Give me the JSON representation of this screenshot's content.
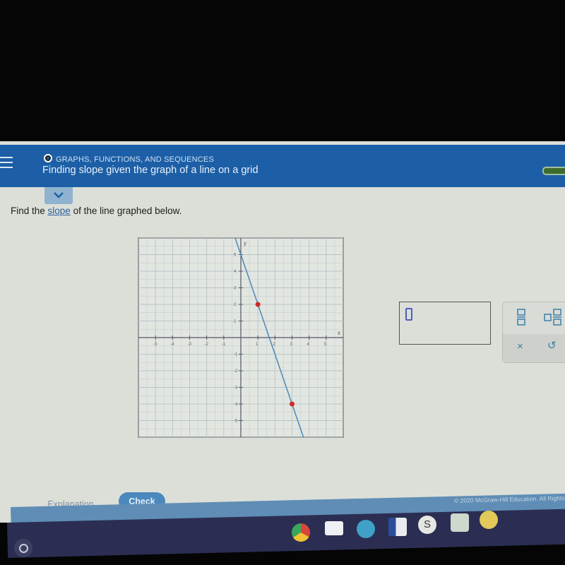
{
  "header": {
    "topic": "GRAPHS, FUNCTIONS, AND SEQUENCES",
    "title": "Finding slope given the graph of a line on a grid"
  },
  "question": {
    "prefix": "Find the ",
    "link": "slope",
    "suffix": " of the line graphed below."
  },
  "graph": {
    "x_axis_label": "x",
    "y_axis_label": "y",
    "x_ticks": [
      -5,
      -4,
      -3,
      -2,
      -1,
      1,
      2,
      3,
      4,
      5
    ],
    "y_ticks": [
      -5,
      -4,
      -3,
      -2,
      -1,
      1,
      2,
      3,
      4,
      5
    ],
    "xlim": [
      -6,
      6
    ],
    "ylim": [
      -6,
      6
    ],
    "line": {
      "slope": -3,
      "intercept": 5,
      "color": "#4a8ab8"
    },
    "points": [
      {
        "x": 1,
        "y": 2
      },
      {
        "x": 3,
        "y": -4
      }
    ],
    "point_color": "#d0282a"
  },
  "answer": {
    "value": ""
  },
  "tools": {
    "fraction": "fraction-icon",
    "mixed_number": "mixed-number-icon",
    "clear": "×",
    "undo": "↺"
  },
  "footer": {
    "explanation": "Explanation",
    "check": "Check",
    "copyright": "© 2020 McGraw-Hill Education. All Rights"
  },
  "taskbar": {
    "apps": [
      "chrome",
      "gmail",
      "zoom",
      "texas",
      "s",
      "mp3",
      "files"
    ]
  },
  "colors": {
    "header_bg": "#1c5fa6",
    "accent": "#4a88bd"
  }
}
